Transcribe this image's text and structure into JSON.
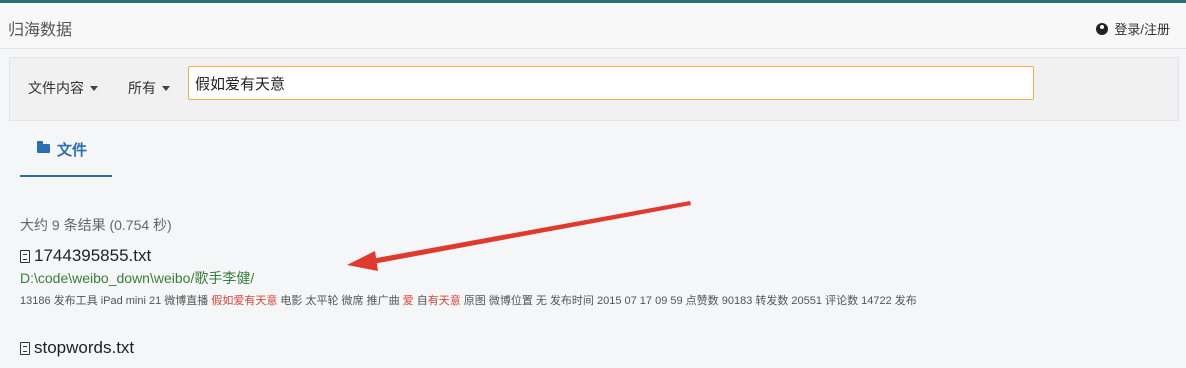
{
  "header": {
    "brand": "归海数据",
    "login": "登录/注册"
  },
  "search": {
    "field_dropdown": "文件内容",
    "scope_dropdown": "所有",
    "query": "假如爱有天意"
  },
  "tabs": [
    {
      "label": "文件"
    }
  ],
  "results_summary": "大约 9 条结果 (0.754 秒)",
  "results": [
    {
      "title": "1744395855.txt",
      "path_prefix": "D:\\code\\weibo_down\\weibo/",
      "path_highlight": "歌手李健",
      "path_suffix": "/",
      "snippet": [
        {
          "text": "13186 发布工具 iPad mini 21 微博直播 ",
          "hl": false
        },
        {
          "text": "假如爱有天意",
          "hl": true
        },
        {
          "text": " 电影 太平轮 微席 推广曲 ",
          "hl": false
        },
        {
          "text": "爱",
          "hl": true
        },
        {
          "text": " 自",
          "hl": false
        },
        {
          "text": "有天意",
          "hl": true
        },
        {
          "text": " 原图 微博位置 无 发布时间 2015 07 17 09 59 点赞数 90183 转发数 20551 评论数 14722 发布",
          "hl": false
        }
      ]
    },
    {
      "title": "stopwords.txt"
    }
  ],
  "colors": {
    "accent": "#2a6fb2",
    "highlight": "#d9453a",
    "path": "#3a7d3a",
    "arrow": "#e0392e"
  }
}
